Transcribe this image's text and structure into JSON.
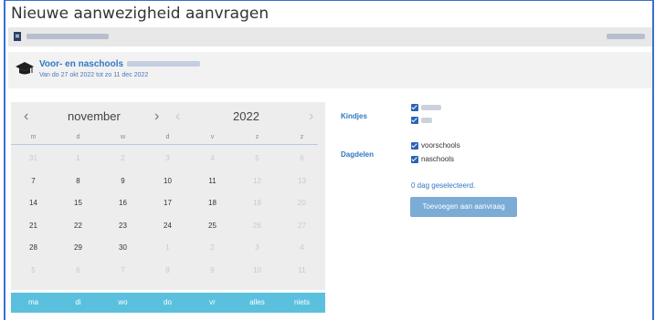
{
  "page": {
    "title": "Nieuwe aanwezigheid aanvragen"
  },
  "course": {
    "name": "Voor- en naschools",
    "dates": "Van do 27 okt 2022 tot zo 11 dec 2022"
  },
  "calendar": {
    "month": "november",
    "year": "2022",
    "prev_icon": "chevron-left-icon",
    "next_icon": "chevron-right-icon",
    "weekdays": [
      "m",
      "d",
      "w",
      "d",
      "v",
      "z",
      "z"
    ],
    "weeks": [
      [
        {
          "d": "31",
          "o": true
        },
        {
          "d": "1",
          "o": true
        },
        {
          "d": "2",
          "o": true
        },
        {
          "d": "3",
          "o": true
        },
        {
          "d": "4",
          "o": true
        },
        {
          "d": "5",
          "o": true
        },
        {
          "d": "6",
          "o": true
        }
      ],
      [
        {
          "d": "7"
        },
        {
          "d": "8"
        },
        {
          "d": "9"
        },
        {
          "d": "10"
        },
        {
          "d": "11"
        },
        {
          "d": "12",
          "o": true
        },
        {
          "d": "13",
          "o": true
        }
      ],
      [
        {
          "d": "14"
        },
        {
          "d": "15"
        },
        {
          "d": "16"
        },
        {
          "d": "17"
        },
        {
          "d": "18"
        },
        {
          "d": "19",
          "o": true
        },
        {
          "d": "20",
          "o": true
        }
      ],
      [
        {
          "d": "21"
        },
        {
          "d": "22"
        },
        {
          "d": "23"
        },
        {
          "d": "24"
        },
        {
          "d": "25"
        },
        {
          "d": "26",
          "o": true
        },
        {
          "d": "27",
          "o": true
        }
      ],
      [
        {
          "d": "28"
        },
        {
          "d": "29"
        },
        {
          "d": "30"
        },
        {
          "d": "1",
          "o": true
        },
        {
          "d": "2",
          "o": true
        },
        {
          "d": "3",
          "o": true
        },
        {
          "d": "4",
          "o": true
        }
      ],
      [
        {
          "d": "5",
          "o": true
        },
        {
          "d": "6",
          "o": true
        },
        {
          "d": "7",
          "o": true
        },
        {
          "d": "8",
          "o": true
        },
        {
          "d": "9",
          "o": true
        },
        {
          "d": "10",
          "o": true
        },
        {
          "d": "11",
          "o": true
        }
      ]
    ],
    "quick_buttons": [
      "ma",
      "di",
      "wo",
      "do",
      "vr",
      "alles",
      "niets"
    ]
  },
  "kindjes": {
    "label": "Kindjes"
  },
  "dagdelen": {
    "label": "Dagdelen",
    "options": [
      "voorschools",
      "naschools"
    ]
  },
  "selection": {
    "count_text": "0 dag geselecteerd."
  },
  "add_button": {
    "label": "Toevoegen aan aanvraag"
  },
  "colors": {
    "accent": "#2f78c4",
    "quick_bar": "#5bc0de",
    "add_button": "#7aacd6",
    "frame": "#3b6fd6"
  }
}
